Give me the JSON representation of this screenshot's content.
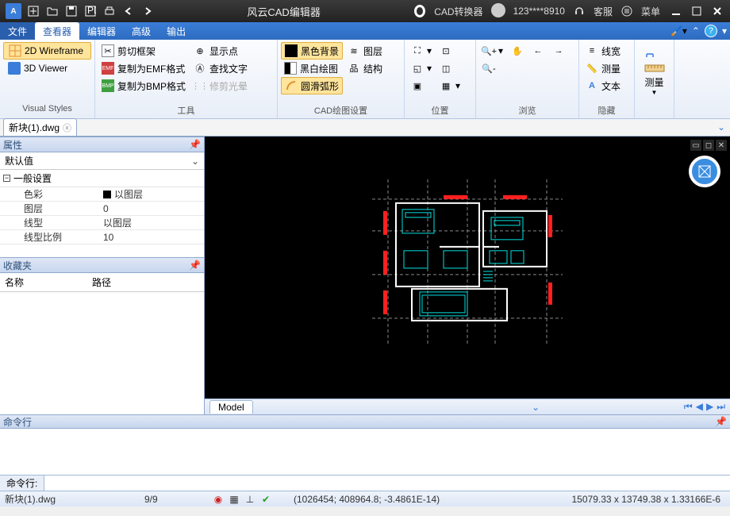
{
  "titlebar": {
    "app_title": "风云CAD编辑器",
    "converter_label": "CAD转换器",
    "user_id": "123****8910",
    "support_label": "客服",
    "menu_label": "菜单"
  },
  "menu": {
    "file": "文件",
    "viewer": "查看器",
    "editor": "编辑器",
    "advanced": "高级",
    "output": "输出"
  },
  "ribbon": {
    "visual_styles": {
      "wireframe": "2D Wireframe",
      "viewer3d": "3D Viewer",
      "group_label": "Visual Styles"
    },
    "tools": {
      "clip_frame": "剪切框架",
      "copy_emf": "复制为EMF格式",
      "copy_bmp": "复制为BMP格式",
      "show_point": "显示点",
      "find_text": "查找文字",
      "trim_halo": "修剪光晕",
      "group_label": "工具"
    },
    "cad_settings": {
      "black_bg": "黑色背景",
      "bw_draw": "黑白绘图",
      "smooth_arc": "圆滑弧形",
      "layers": "图层",
      "structure": "结构",
      "group_label": "CAD绘图设置"
    },
    "position": {
      "group_label": "位置"
    },
    "browse": {
      "group_label": "浏览"
    },
    "hide": {
      "linewidth": "线宽",
      "measure": "测量",
      "text": "文本",
      "group_label": "隐藏"
    },
    "measure_big": "测量"
  },
  "file_tab": {
    "name": "新块(1).dwg"
  },
  "properties": {
    "panel_title": "属性",
    "default_label": "默认值",
    "section_general": "一般设置",
    "rows": [
      {
        "k": "色彩",
        "v": "以图层",
        "swatch": true
      },
      {
        "k": "图层",
        "v": "0"
      },
      {
        "k": "线型",
        "v": "以图层"
      },
      {
        "k": "线型比例",
        "v": "10"
      }
    ]
  },
  "favorites": {
    "panel_title": "收藏夹",
    "col_name": "名称",
    "col_path": "路径"
  },
  "model_tab": "Model",
  "command": {
    "panel_title": "命令行",
    "prompt_label": "命令行:"
  },
  "status": {
    "file": "新块(1).dwg",
    "progress": "9/9",
    "coords": "(1026454; 408964.8; -3.4861E-14)",
    "dims": "15079.33 x 13749.38 x 1.33166E-6"
  }
}
